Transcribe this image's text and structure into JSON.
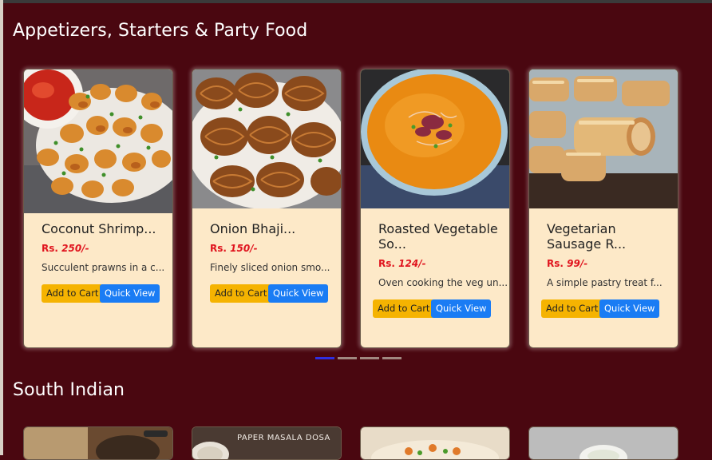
{
  "sections": [
    {
      "title": "Appetizers, Starters & Party Food",
      "items": [
        {
          "name": "Coconut Shrimp...",
          "price_label": "Rs.",
          "price": "250/-",
          "desc": "Succulent prawns in a c...",
          "cart_label": "Add to Cart",
          "quick_label": "Quick View",
          "image": "coconut-shrimp-photo"
        },
        {
          "name": "Onion Bhaji...",
          "price_label": "Rs.",
          "price": "150/-",
          "desc": "Finely sliced onion smo...",
          "cart_label": "Add to Cart",
          "quick_label": "Quick View",
          "image": "onion-bhaji-photo"
        },
        {
          "name": "Roasted Vegetable So...",
          "price_label": "Rs.",
          "price": "124/-",
          "desc": "Oven cooking the veg un...",
          "cart_label": "Add to Cart",
          "quick_label": "Quick View",
          "image": "roasted-vegetable-soup-photo"
        },
        {
          "name": "Vegetarian Sausage R...",
          "price_label": "Rs.",
          "price": "99/-",
          "desc": "A simple pastry treat f...",
          "cart_label": "Add to Cart",
          "quick_label": "Quick View",
          "image": "vegetarian-sausage-roll-photo"
        }
      ],
      "carousel": {
        "pages": 4,
        "active": 0
      }
    },
    {
      "title": "South Indian",
      "items": [
        {
          "image": "south-indian-dish-1-photo"
        },
        {
          "image": "paper-masala-dosa-photo",
          "overlay_text": "PAPER MASALA DOSA"
        },
        {
          "image": "south-indian-dish-3-photo"
        },
        {
          "image": "south-indian-dish-4-photo"
        }
      ]
    }
  ],
  "colors": {
    "background": "#4a0710",
    "card": "#fde9c8",
    "price": "#e0141e",
    "cart_button": "#f5b301",
    "quick_button": "#1a7cf4",
    "carousel_active": "#2f2fe0"
  }
}
